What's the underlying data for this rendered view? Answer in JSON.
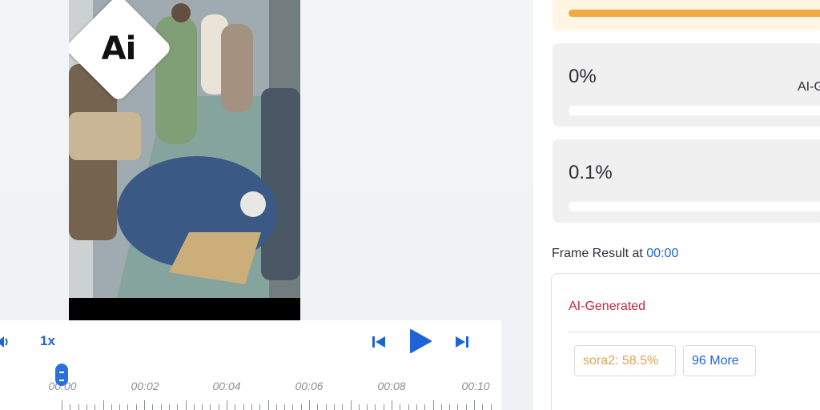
{
  "video": {
    "logo_text": "Ai"
  },
  "player": {
    "speed_label": "1x",
    "timeline_labels": [
      "00:00",
      "00:02",
      "00:04",
      "00:06",
      "00:08",
      "00:10"
    ]
  },
  "results": {
    "cards": [
      {
        "value": "0%",
        "side_label": "AI-G"
      },
      {
        "value": "0.1%"
      }
    ],
    "frame_result_label": "Frame Result at",
    "frame_time": "00:00",
    "verdict": "AI-Generated",
    "model_tag": "sora2: 58.5%",
    "more_tag": "96 More"
  },
  "colors": {
    "accent": "#1f63d6",
    "verdict": "#c0283b",
    "warning_bar": "#f1a845",
    "model_tag": "#e0a254"
  }
}
